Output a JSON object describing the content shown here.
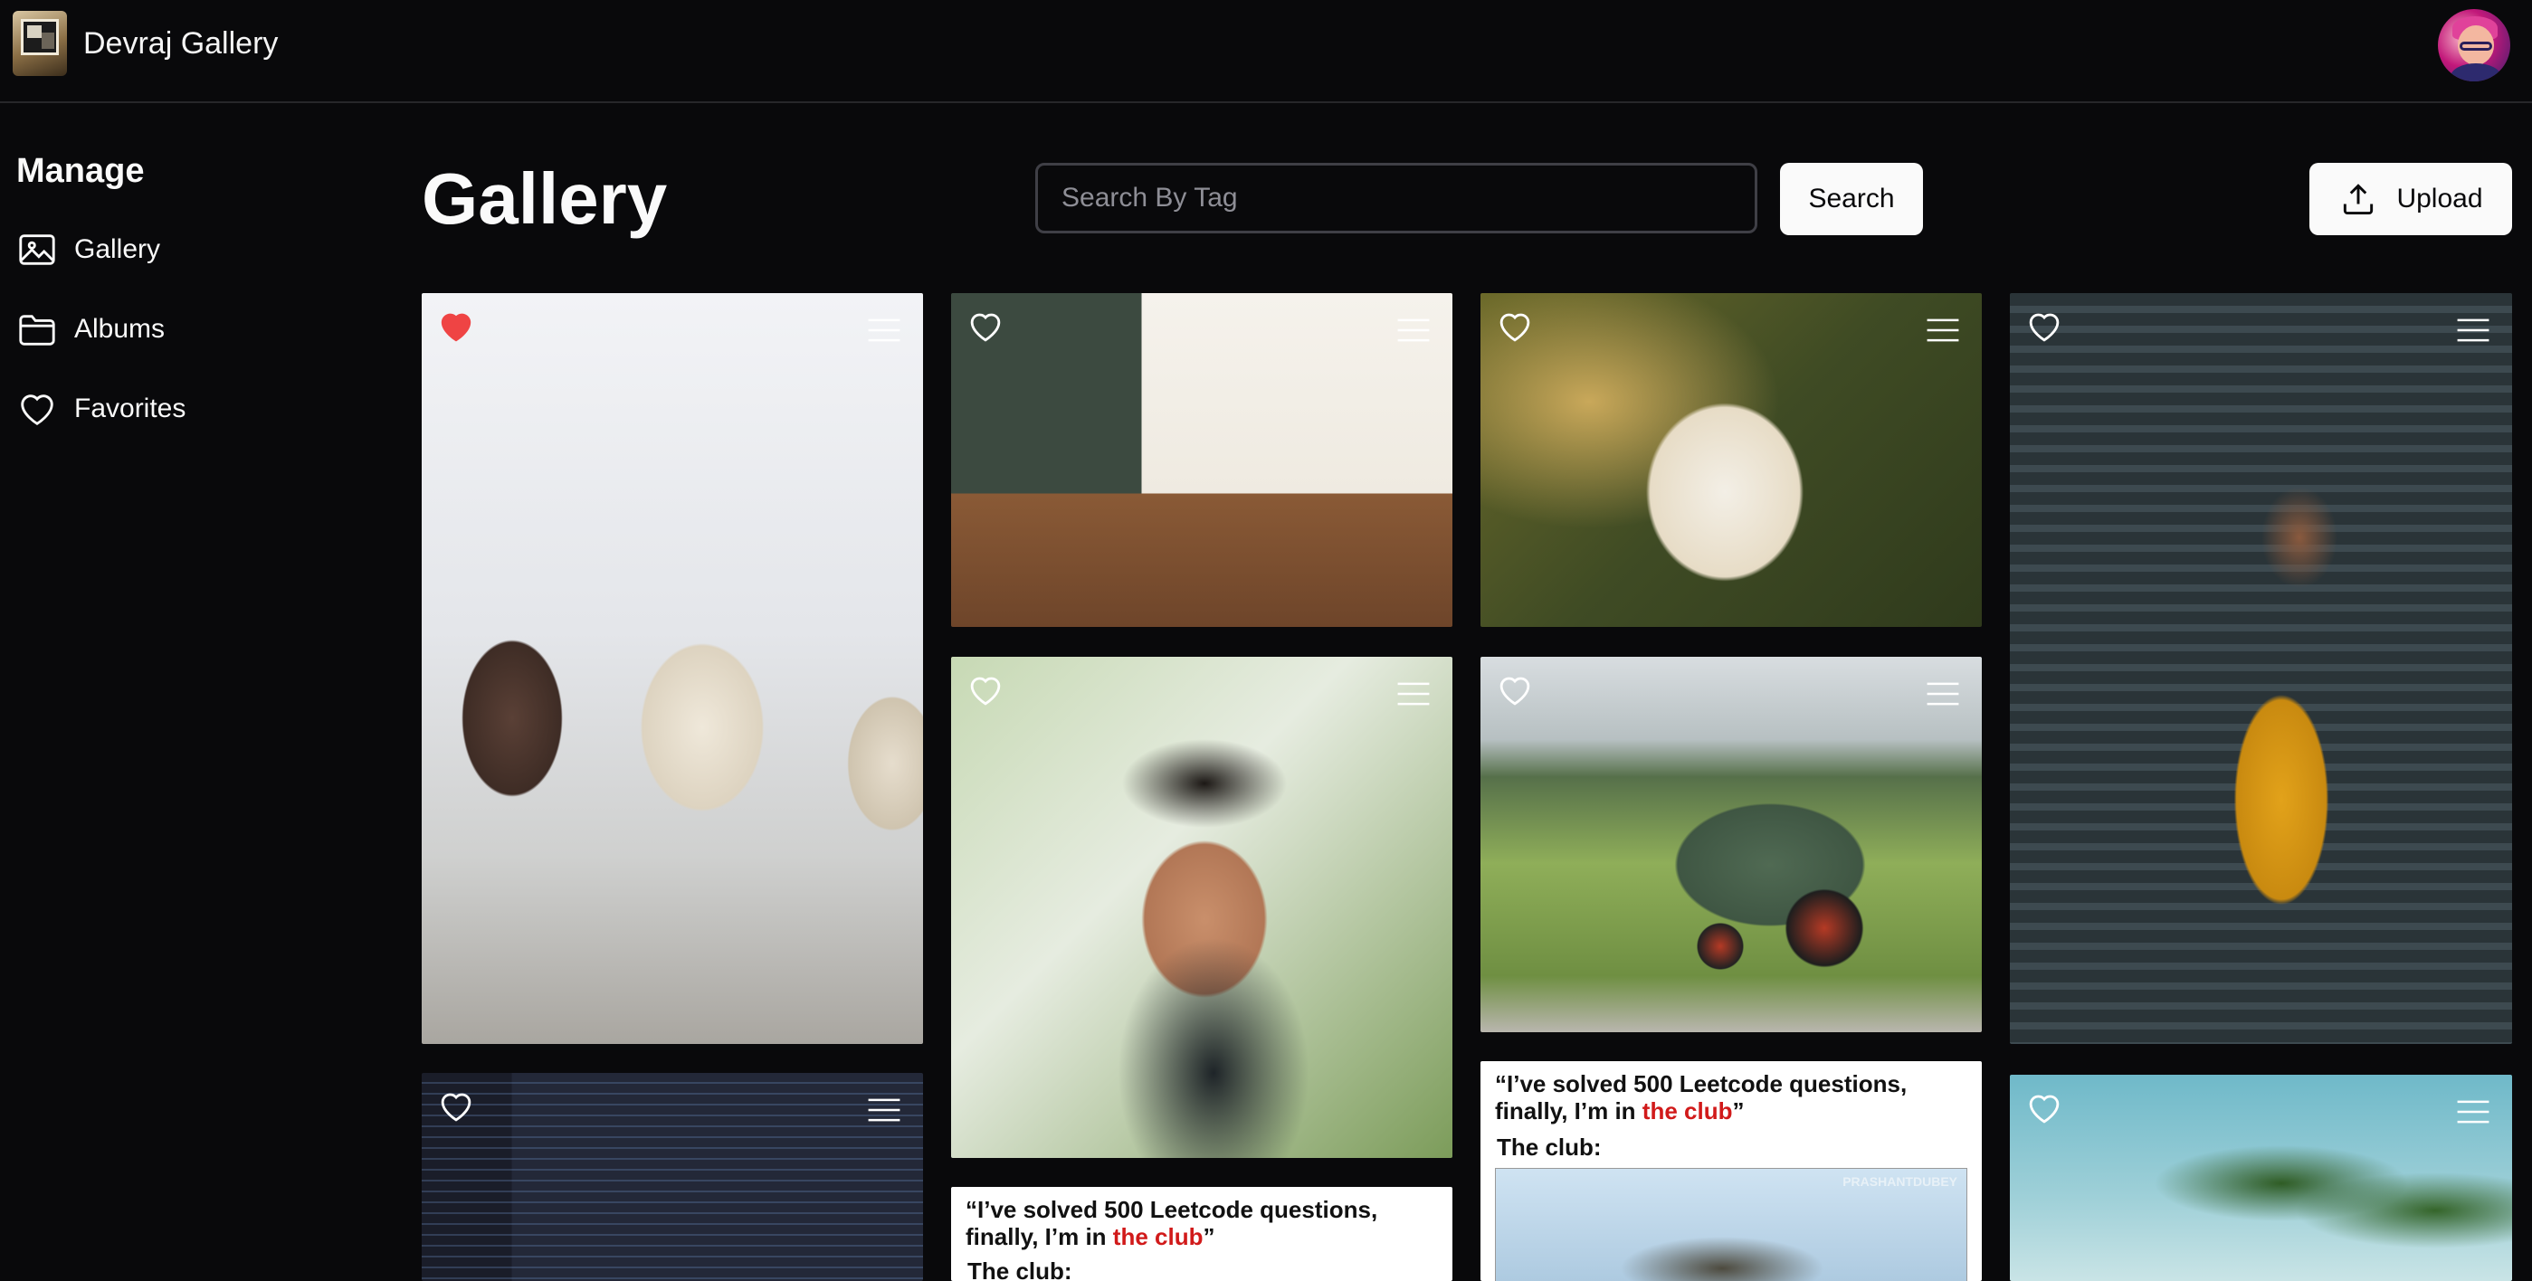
{
  "header": {
    "app_name": "Devraj Gallery"
  },
  "sidebar": {
    "title": "Manage",
    "items": [
      {
        "label": "Gallery",
        "icon": "image-icon"
      },
      {
        "label": "Albums",
        "icon": "folder-icon"
      },
      {
        "label": "Favorites",
        "icon": "heart-icon"
      }
    ]
  },
  "main": {
    "title": "Gallery",
    "search": {
      "placeholder": "Search By Tag",
      "value": "",
      "button_label": "Search"
    },
    "upload_label": "Upload"
  },
  "gallery": {
    "images": [
      {
        "subject": "sheep",
        "favorited": true
      },
      {
        "subject": "kitchen",
        "favorited": false
      },
      {
        "subject": "dog",
        "favorited": false
      },
      {
        "subject": "woman",
        "favorited": false
      },
      {
        "subject": "man",
        "favorited": false
      },
      {
        "subject": "tractor",
        "favorited": false
      },
      {
        "subject": "code",
        "favorited": false
      },
      {
        "subject": "meme",
        "favorited": false
      },
      {
        "subject": "meme",
        "favorited": false
      },
      {
        "subject": "palm",
        "favorited": false
      }
    ],
    "meme_text": {
      "quote_before": "“I’ve solved 500 Leetcode questions, finally, I’m in ",
      "quote_highlight": "the club",
      "quote_after": "”",
      "club_label": "The club:",
      "watermark": "PRASHANTDUBEY"
    }
  },
  "colors": {
    "background": "#09090b",
    "foreground": "#fafafa",
    "favorite": "#ef4444",
    "highlight": "#d11a1a"
  }
}
